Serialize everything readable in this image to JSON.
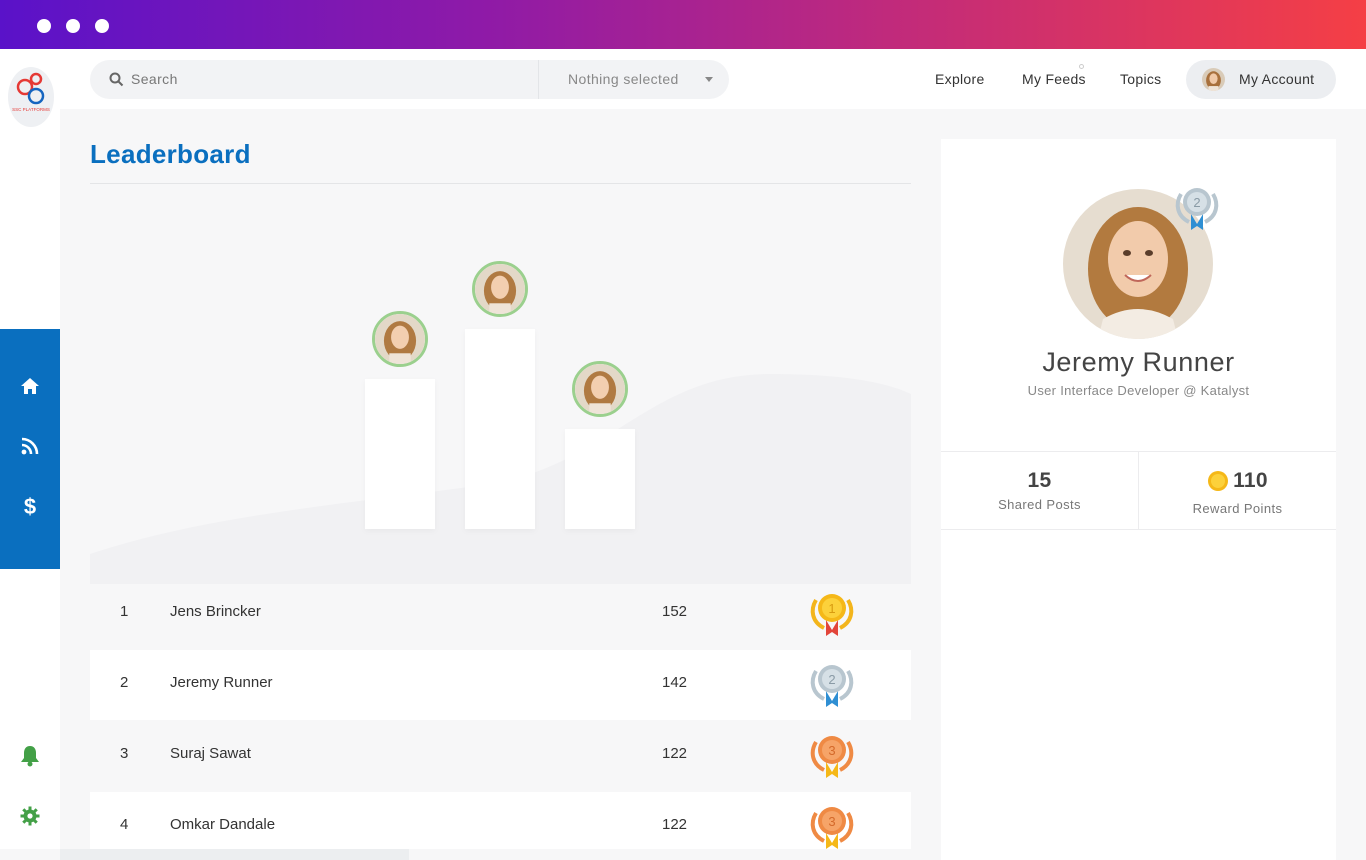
{
  "window": {
    "dots": 3
  },
  "brand": {
    "logo_text": "SSC PLATFORMS"
  },
  "search": {
    "placeholder": "Search",
    "select_value": "Nothing selected"
  },
  "nav": {
    "explore": "Explore",
    "feeds": "My Feeds",
    "topics": "Topics",
    "account": "My Account"
  },
  "rail": {
    "icons": [
      "home-icon",
      "rss-icon",
      "dollar-icon",
      "bell-icon",
      "gear-icon"
    ]
  },
  "leaderboard": {
    "title": "Leaderboard",
    "rows": [
      {
        "rank": "1",
        "name": "Jens Brincker",
        "score": "152",
        "medal": "gold-medal-icon"
      },
      {
        "rank": "2",
        "name": "Jeremy Runner",
        "score": "142",
        "medal": "silver-medal-icon"
      },
      {
        "rank": "3",
        "name": "Suraj Sawat",
        "score": "122",
        "medal": "bronze-medal-icon"
      },
      {
        "rank": "4",
        "name": "Omkar Dandale",
        "score": "122",
        "medal": "bronze-medal-icon"
      }
    ]
  },
  "profile": {
    "name": "Jeremy Runner",
    "role": "User Interface Developer @ Katalyst",
    "shared_posts": "15",
    "shared_posts_label": "Shared Posts",
    "reward_points": "110",
    "reward_points_label": "Reward Points",
    "rank_badge": "2"
  },
  "colors": {
    "primary": "#0a6fbf",
    "gold": "#f5b818",
    "silver": "#b8c6cf",
    "bronze": "#ef8a44",
    "accent_green": "#4caf50"
  }
}
